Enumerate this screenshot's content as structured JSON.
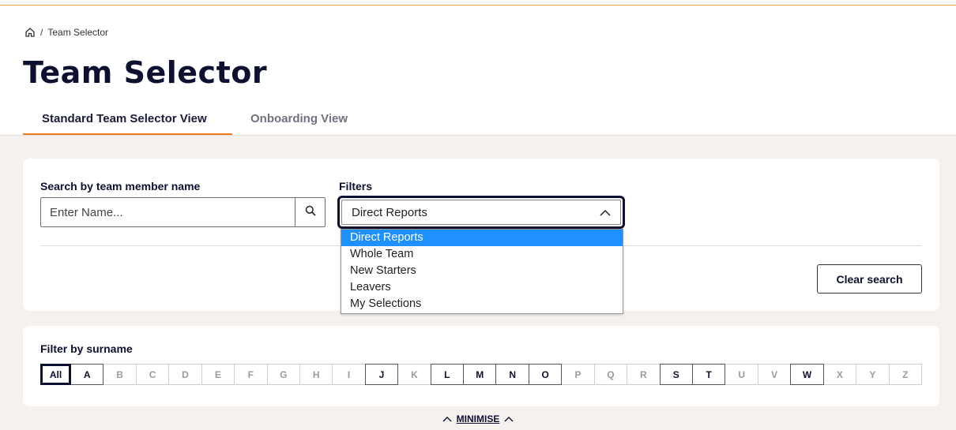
{
  "breadcrumb": {
    "home_icon": "home-icon",
    "separator": "/",
    "current": "Team Selector"
  },
  "page": {
    "title": "Team Selector"
  },
  "tabs": [
    {
      "label": "Standard Team Selector View",
      "active": true
    },
    {
      "label": "Onboarding View",
      "active": false
    }
  ],
  "search": {
    "label": "Search by team member name",
    "placeholder": "Enter Name...",
    "value": "",
    "icon": "search-icon"
  },
  "filters": {
    "label": "Filters",
    "selected": "Direct Reports",
    "options": [
      "Direct Reports",
      "Whole Team",
      "New Starters",
      "Leavers",
      "My Selections"
    ]
  },
  "clear_button": "Clear search",
  "surname_filter": {
    "label": "Filter by surname",
    "letters": [
      "All",
      "A",
      "B",
      "C",
      "D",
      "E",
      "F",
      "G",
      "H",
      "I",
      "J",
      "K",
      "L",
      "M",
      "N",
      "O",
      "P",
      "Q",
      "R",
      "S",
      "T",
      "U",
      "V",
      "W",
      "X",
      "Y",
      "Z"
    ],
    "enabled": [
      "All",
      "A",
      "J",
      "L",
      "M",
      "N",
      "O",
      "S",
      "T",
      "W"
    ],
    "selected": "All"
  },
  "minimise": {
    "label": "MINIMISE"
  },
  "colors": {
    "accent": "#f07b1b",
    "navy": "#0e1030",
    "selected_option": "#1e90ff",
    "panel_bg": "#f4f1ee"
  }
}
